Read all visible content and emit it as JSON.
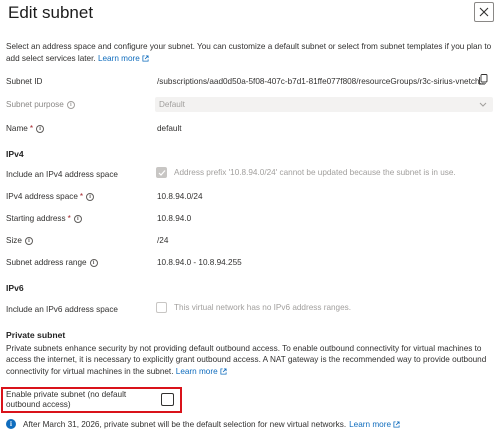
{
  "header": {
    "title": "Edit subnet",
    "close_label": "Close"
  },
  "intro": {
    "text": "Select an address space and configure your subnet. You can customize a default subnet or select from subnet templates if you plan to add select services later.",
    "learn_more": "Learn more"
  },
  "fields": {
    "subnet_id": {
      "label": "Subnet ID",
      "value": "/subscriptions/aad0d50a-5f08-407c-b7d1-81ffe077f808/resourceGroups/r3c-sirius-vnetch..."
    },
    "subnet_purpose": {
      "label": "Subnet purpose",
      "value": "Default"
    },
    "name": {
      "label": "Name",
      "required_mark": "*",
      "value": "default"
    }
  },
  "ipv4": {
    "heading": "IPv4",
    "include_label": "Include an IPv4 address space",
    "include_checked": true,
    "include_note": "Address prefix '10.8.94.0/24' cannot be updated because the subnet is in use.",
    "address_space_label": "IPv4 address space",
    "address_space_required": "*",
    "address_space_value": "10.8.94.0/24",
    "starting_address_label": "Starting address",
    "starting_address_required": "*",
    "starting_address_value": "10.8.94.0",
    "size_label": "Size",
    "size_value": "/24",
    "range_label": "Subnet address range",
    "range_value": "10.8.94.0 - 10.8.94.255"
  },
  "ipv6": {
    "heading": "IPv6",
    "include_label": "Include an IPv6 address space",
    "include_checked": false,
    "include_note": "This virtual network has no IPv6 address ranges."
  },
  "private_subnet": {
    "heading": "Private subnet",
    "description": "Private subnets enhance security by not providing default outbound access. To enable outbound connectivity for virtual machines to access the internet, it is necessary to explicitly grant outbound access. A NAT gateway is the recommended way to provide outbound connectivity for virtual machines in the subnet.",
    "learn_more": "Learn more",
    "enable_label": "Enable private subnet (no default outbound access)",
    "enable_checked": false,
    "notice": "After March 31, 2026, private subnet will be the default selection for new virtual networks.",
    "notice_learn_more": "Learn more"
  },
  "colors": {
    "link": "#0f6cbd",
    "highlight": "#d9131a",
    "required": "#a4262c"
  },
  "icons": {
    "close": "close-icon",
    "copy": "copy-icon",
    "info": "info-icon",
    "external": "external-link-icon",
    "chevron": "chevron-down-icon",
    "notice": "info-filled-icon"
  }
}
